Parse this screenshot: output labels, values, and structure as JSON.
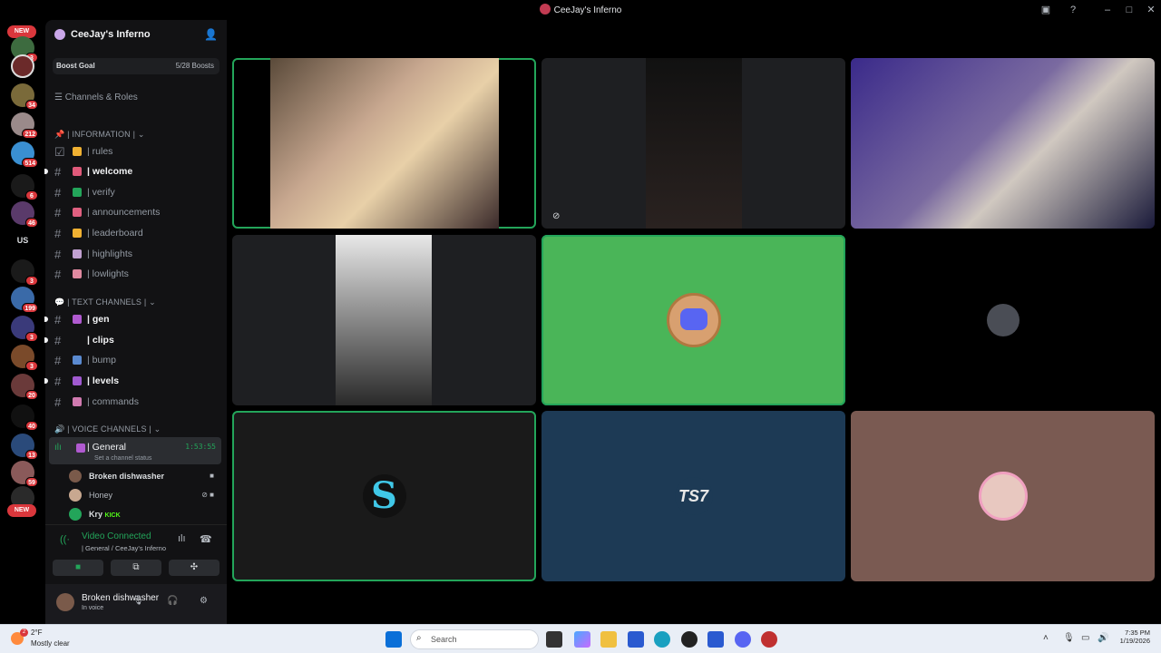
{
  "window": {
    "title": "CeeJay's Inferno"
  },
  "rail": {
    "badges": [
      "3",
      "34",
      "212",
      "514",
      "6",
      "46",
      "3",
      "199",
      "3",
      "3",
      "20",
      "40",
      "13",
      "59"
    ],
    "new_label": "NEW",
    "us_label": "US"
  },
  "server": {
    "name": "CeeJay's Inferno",
    "boost_label": "Boost Goal",
    "boost_count": "5/28 Boosts",
    "channels_roles": "Channels & Roles"
  },
  "categories": {
    "information": "| INFORMATION |",
    "text": "| TEXT CHANNELS |",
    "voice": "| VOICE CHANNELS |"
  },
  "channels": [
    {
      "label": "| rules",
      "bold": false
    },
    {
      "label": "| welcome",
      "bold": true
    },
    {
      "label": "| verify",
      "bold": false
    },
    {
      "label": "| announcements",
      "bold": false
    },
    {
      "label": "| leaderboard",
      "bold": false
    },
    {
      "label": "| highlights",
      "bold": false
    },
    {
      "label": "| lowlights",
      "bold": false
    },
    {
      "label": "| gen",
      "bold": true
    },
    {
      "label": "| clips",
      "bold": true
    },
    {
      "label": "| bump",
      "bold": false
    },
    {
      "label": "| levels",
      "bold": true
    },
    {
      "label": "| commands",
      "bold": false
    }
  ],
  "voice": {
    "channel": "| General",
    "time": "1:53:55",
    "status": "Set a channel status",
    "members": [
      {
        "name": "Broken dishwasher"
      },
      {
        "name": "Honey"
      },
      {
        "name": "Kry",
        "tag": "KICK"
      }
    ]
  },
  "connection": {
    "title": "Video Connected",
    "subtitle": "| General / CeeJay's Inferno"
  },
  "user": {
    "name": "Broken dishwasher",
    "status": "In voice"
  },
  "taskbar": {
    "temp": "2°F",
    "condition": "Mostly clear",
    "weather_badge": "2",
    "search": "Search",
    "time": "7:35 PM",
    "date": "1/19/2026"
  },
  "colors": {
    "speaking": "#23a55a",
    "green_tile": "#4ab558",
    "blue_tile": "#1d3a55",
    "pink_tile": "#7a5a52"
  }
}
